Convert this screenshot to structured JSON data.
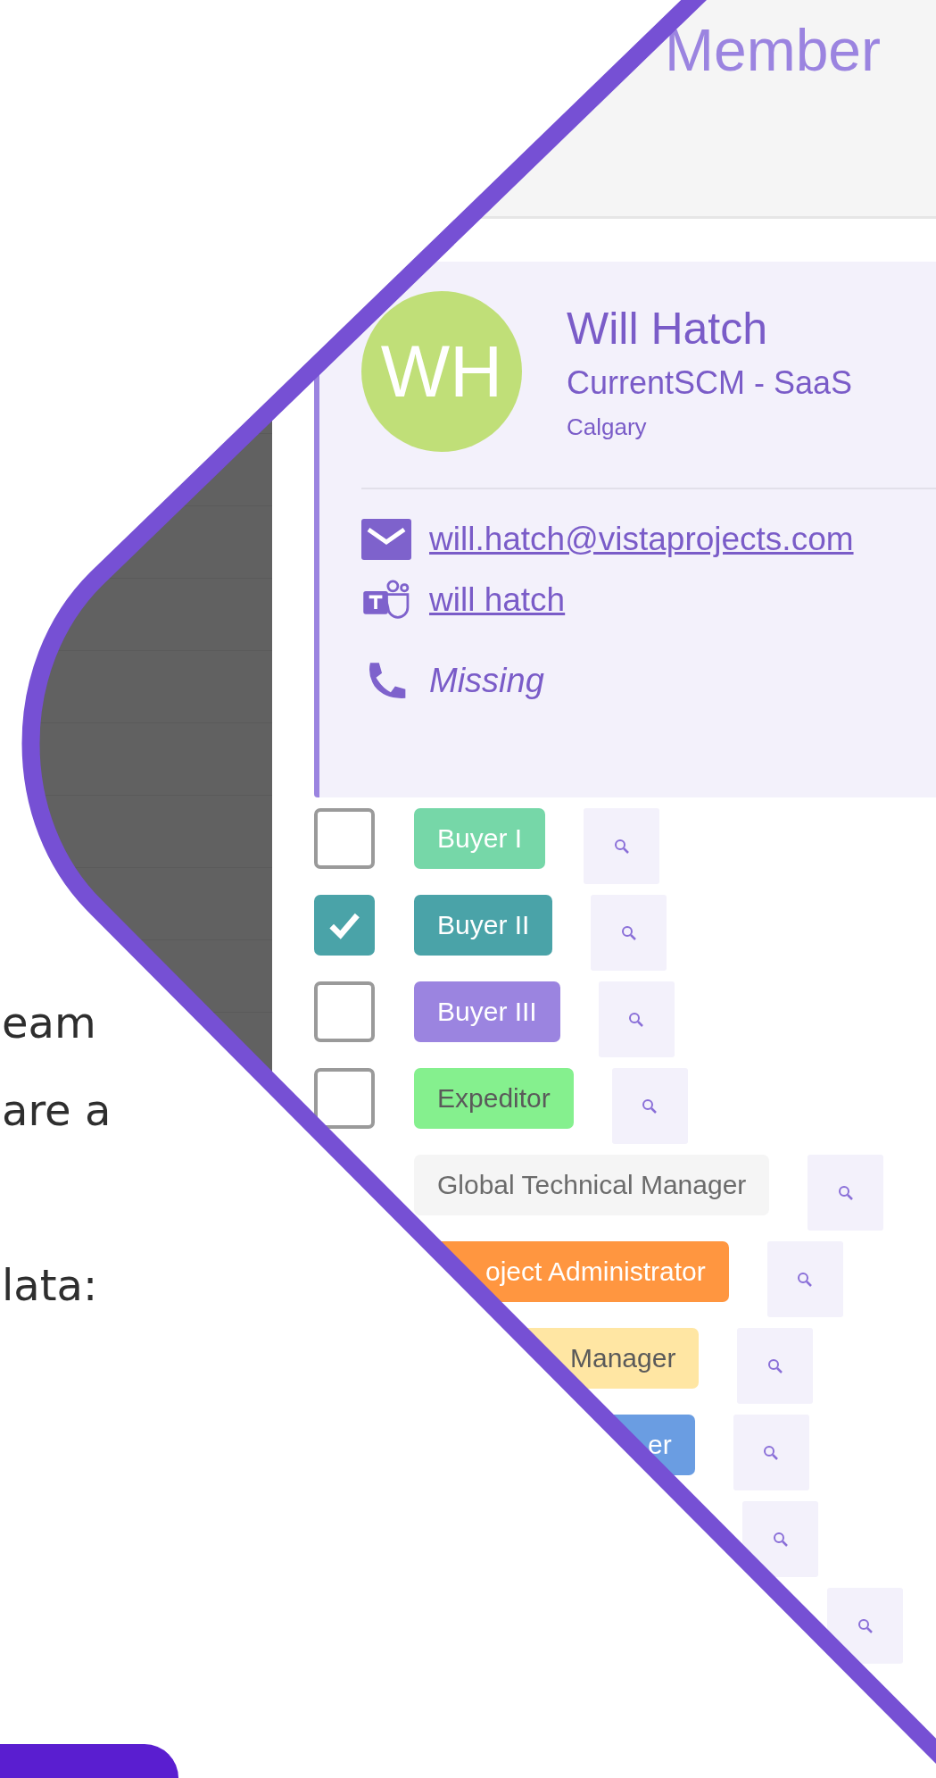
{
  "intro_lines": [
    "eam",
    "are a",
    "lata:"
  ],
  "header": {
    "title": "Member"
  },
  "profile": {
    "initials": "WH",
    "name": "Will Hatch",
    "company": "CurrentSCM - SaaS",
    "location": "Calgary",
    "email": "will.hatch@vistaprojects.com",
    "teams": "will hatch",
    "phone": "Missing"
  },
  "roles": [
    {
      "kind": "role",
      "label": "Buyer I",
      "checked": false,
      "color": "#76d7a8"
    },
    {
      "kind": "role",
      "label": "Buyer II",
      "checked": true,
      "color": "#4aa3a8"
    },
    {
      "kind": "role",
      "label": "Buyer III",
      "checked": false,
      "color": "#9b84e0"
    },
    {
      "kind": "role",
      "label": "Expeditor",
      "checked": false,
      "color": "#85f08e"
    },
    {
      "kind": "role",
      "label": "Global Technical Manager",
      "color": "#f5f5f5"
    },
    {
      "kind": "role",
      "label": "oject Administrator",
      "color": "#ff9640"
    },
    {
      "kind": "role",
      "label": "Manager",
      "color": "#ffe6a3"
    },
    {
      "kind": "role",
      "label": "er",
      "color": "#6a9de2"
    },
    {
      "kind": "search-only"
    },
    {
      "kind": "search-only"
    }
  ]
}
